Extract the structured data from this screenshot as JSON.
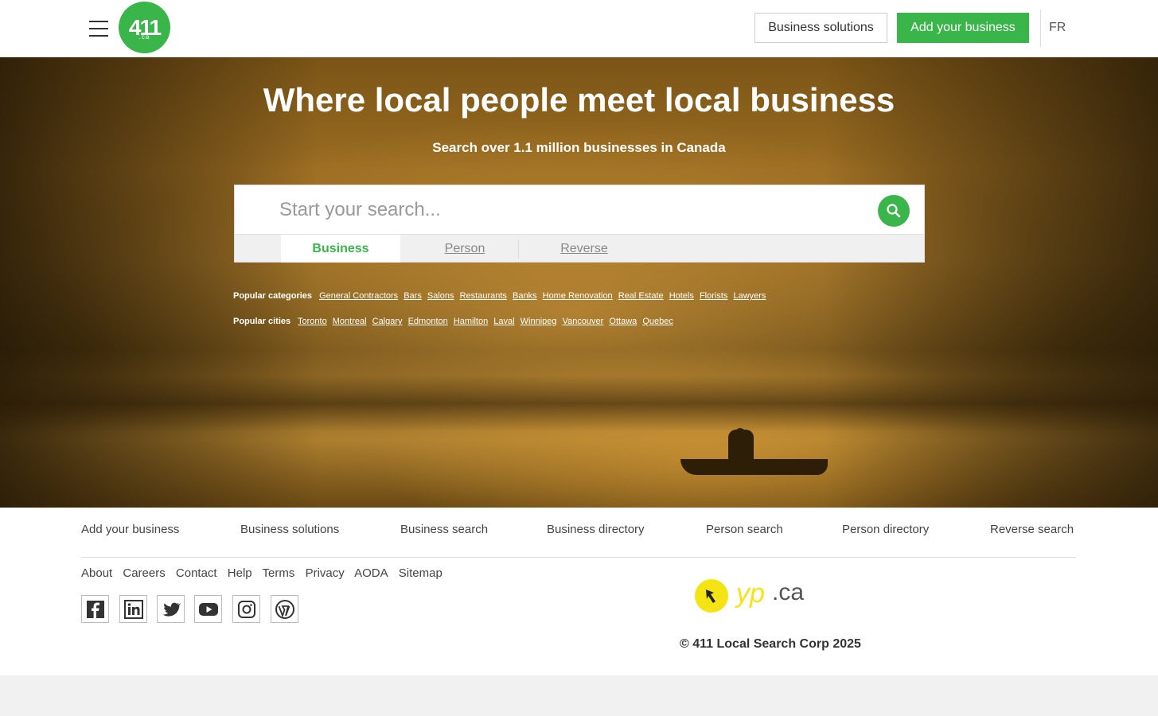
{
  "header": {
    "logo_text": "411",
    "logo_sub": ".ca",
    "business_solutions_label": "Business solutions",
    "add_business_label": "Add your business",
    "lang_label": "FR"
  },
  "hero": {
    "title": "Where local people meet local business",
    "subtitle": "Search over 1.1 million businesses in Canada",
    "search_placeholder": "Start your search...",
    "tabs": [
      {
        "label": "Business",
        "active": true
      },
      {
        "label": "Person",
        "active": false
      },
      {
        "label": "Reverse",
        "active": false
      }
    ],
    "popular_categories_label": "Popular categories",
    "popular_categories": [
      "General Contractors",
      "Bars",
      "Salons",
      "Restaurants",
      "Banks",
      "Home Renovation",
      "Real Estate",
      "Hotels",
      "Florists",
      "Lawyers"
    ],
    "popular_cities_label": "Popular cities",
    "popular_cities": [
      "Toronto",
      "Montreal",
      "Calgary",
      "Edmonton",
      "Hamilton",
      "Laval",
      "Winnipeg",
      "Vancouver",
      "Ottawa",
      "Quebec"
    ]
  },
  "footer": {
    "nav": [
      "Add your business",
      "Business solutions",
      "Business search",
      "Business directory",
      "Person search",
      "Person directory",
      "Reverse search"
    ],
    "links": [
      "About",
      "Careers",
      "Contact",
      "Help",
      "Terms",
      "Privacy",
      "AODA",
      "Sitemap"
    ],
    "social": [
      "facebook-icon",
      "linkedin-icon",
      "twitter-icon",
      "youtube-icon",
      "instagram-icon",
      "wordpress-icon"
    ],
    "yp_logo_text_yp": "yp",
    "yp_logo_text_ca": ".ca",
    "copyright": "© 411 Local Search Corp 2025"
  },
  "colors": {
    "brand_green": "#3ab54a",
    "yp_yellow": "#f5e414"
  }
}
